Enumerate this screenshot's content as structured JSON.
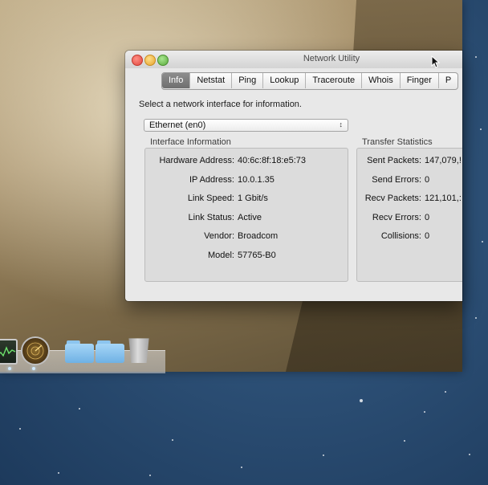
{
  "window": {
    "title": "Network Utility"
  },
  "tabs": [
    "Info",
    "Netstat",
    "Ping",
    "Lookup",
    "Traceroute",
    "Whois",
    "Finger",
    "P"
  ],
  "select_label": "Select a network interface for information.",
  "interface_select": {
    "value": "Ethernet (en0)"
  },
  "interface_info": {
    "title": "Interface Information",
    "rows": [
      {
        "label": "Hardware Address:",
        "value": "40:6c:8f:18:e5:73"
      },
      {
        "label": "IP Address:",
        "value": "10.0.1.35"
      },
      {
        "label": "Link Speed:",
        "value": "1 Gbit/s"
      },
      {
        "label": "Link Status:",
        "value": "Active"
      },
      {
        "label": "Vendor:",
        "value": "Broadcom"
      },
      {
        "label": "Model:",
        "value": "57765-B0"
      }
    ]
  },
  "transfer_stats": {
    "title": "Transfer Statistics",
    "rows": [
      {
        "label": "Sent Packets:",
        "value": "147,079,!"
      },
      {
        "label": "Send Errors:",
        "value": "0"
      },
      {
        "label": "Recv Packets:",
        "value": "121,101,:"
      },
      {
        "label": "Recv Errors:",
        "value": "0"
      },
      {
        "label": "Collisions:",
        "value": "0"
      }
    ]
  },
  "dock": {
    "items": [
      "activity-monitor-icon",
      "network-radar-icon",
      "applications-folder-icon",
      "folder-icon",
      "trash-icon"
    ]
  }
}
